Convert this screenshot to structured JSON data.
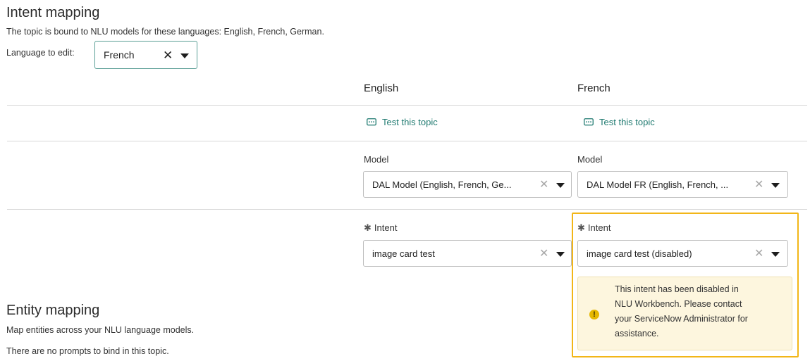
{
  "intent_mapping": {
    "title": "Intent mapping",
    "description": "The topic is bound to NLU models for these languages: English, French, German.",
    "language_label": "Language to edit:",
    "language_value": "French"
  },
  "columns": [
    {
      "heading": "English",
      "test_link": "Test this topic",
      "model_label": "Model",
      "model_value": "DAL Model (English, French, Ge...",
      "intent_label": "Intent",
      "intent_value": "image card test"
    },
    {
      "heading": "French",
      "test_link": "Test this topic",
      "model_label": "Model",
      "model_value": "DAL Model FR (English, French, ...",
      "intent_label": "Intent",
      "intent_value": "image card test (disabled)"
    }
  ],
  "warning": {
    "lines": [
      "This intent has been disabled in",
      "NLU Workbench. Please contact",
      "your ServiceNow Administrator for",
      "assistance."
    ]
  },
  "entity_mapping": {
    "title": "Entity mapping",
    "description": "Map entities across your NLU language models.",
    "empty_message": "There are no prompts to bind in this topic."
  },
  "icons": {
    "required": "asterisk-icon",
    "test": "chat-bubble-icon",
    "warning": "exclamation-icon",
    "clear": "x-icon",
    "dropdown": "caret-down-icon"
  },
  "colors": {
    "accent": "#1f7a70",
    "highlight": "#f2b618",
    "warning_bg": "#fdf6de"
  }
}
